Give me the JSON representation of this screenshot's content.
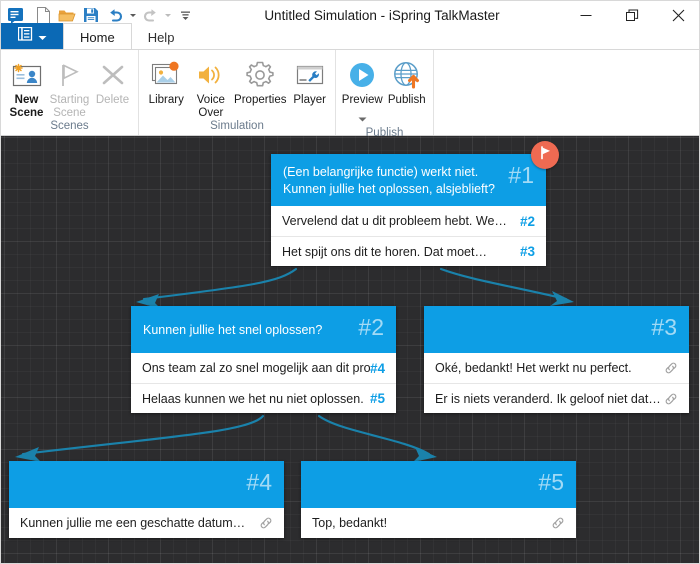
{
  "window": {
    "title": "Untitled Simulation - iSpring TalkMaster",
    "app_icon": "speech-bubble-icon",
    "controls": {
      "minimize": "minimize-icon",
      "restore": "restore-icon",
      "close": "close-icon"
    }
  },
  "quick_access": [
    {
      "name": "new-file-icon",
      "label": "New"
    },
    {
      "name": "open-folder-icon",
      "label": "Open"
    },
    {
      "name": "save-icon",
      "label": "Save"
    },
    {
      "name": "undo-icon",
      "label": "Undo",
      "has_caret": true,
      "disabled": false
    },
    {
      "name": "redo-icon",
      "label": "Redo",
      "has_caret": true,
      "disabled": true
    },
    {
      "name": "customize-toolbar-icon",
      "label": "Customize Quick Access Toolbar"
    }
  ],
  "ribbon": {
    "file_button": {
      "icon": "menu-list-icon",
      "caret": "chevron-down-icon"
    },
    "tabs": [
      {
        "label": "Home",
        "active": true
      },
      {
        "label": "Help",
        "active": false
      }
    ],
    "groups": [
      {
        "label": "Scenes",
        "buttons": [
          {
            "label": "New\nScene",
            "icon": "new-scene-icon",
            "disabled": false
          },
          {
            "label": "Starting\nScene",
            "icon": "flag-icon",
            "disabled": true
          },
          {
            "label": "Delete",
            "icon": "delete-x-icon",
            "disabled": true
          }
        ]
      },
      {
        "label": "Simulation",
        "buttons": [
          {
            "label": "Library",
            "icon": "library-images-icon",
            "disabled": false
          },
          {
            "label": "Voice\nOver",
            "icon": "speaker-icon",
            "disabled": false
          },
          {
            "label": "Properties",
            "icon": "gear-icon",
            "disabled": false
          },
          {
            "label": "Player",
            "icon": "player-wrench-icon",
            "disabled": false
          }
        ]
      },
      {
        "label": "Publish",
        "buttons": [
          {
            "label": "Preview",
            "icon": "play-circle-icon",
            "disabled": false,
            "caret": true
          },
          {
            "label": "Publish",
            "icon": "globe-upload-icon",
            "disabled": false
          }
        ]
      }
    ]
  },
  "canvas": {
    "background_color": "#2c2c2e",
    "node_header_color": "#0d9ee5",
    "start_badge_color": "#ef6a52",
    "connector_color": "#1a82ab",
    "nodes": [
      {
        "id": "1",
        "number": "#1",
        "question": "(Een belangrijke functie) werkt niet.\nKunnen jullie het oplossen, alsjeblieft?",
        "is_start": true,
        "start_badge_icon": "flag-badge-icon",
        "replies": [
          {
            "text": "Vervelend dat u dit probleem hebt. We…",
            "target": "#2",
            "link": false
          },
          {
            "text": "Het spijt ons dit te horen. Dat moet…",
            "target": "#3",
            "link": false
          }
        ]
      },
      {
        "id": "2",
        "number": "#2",
        "question": "Kunnen jullie het snel oplossen?",
        "is_start": false,
        "replies": [
          {
            "text": "Ons team zal zo snel mogelijk aan dit pro…",
            "target": "#4",
            "link": false
          },
          {
            "text": "Helaas kunnen we het nu niet oplossen.",
            "target": "#5",
            "link": false
          }
        ]
      },
      {
        "id": "3",
        "number": "#3",
        "question": "",
        "is_start": false,
        "replies": [
          {
            "text": "Oké, bedankt! Het werkt nu perfect.",
            "target": "",
            "link": true
          },
          {
            "text": "Er is niets veranderd. Ik geloof niet dat…",
            "target": "",
            "link": true
          }
        ]
      },
      {
        "id": "4",
        "number": "#4",
        "question": "",
        "is_start": false,
        "replies": [
          {
            "text": "Kunnen jullie me een geschatte datum…",
            "target": "",
            "link": true
          }
        ]
      },
      {
        "id": "5",
        "number": "#5",
        "question": "",
        "is_start": false,
        "replies": [
          {
            "text": "Top, bedankt!",
            "target": "",
            "link": true
          }
        ]
      }
    ]
  }
}
